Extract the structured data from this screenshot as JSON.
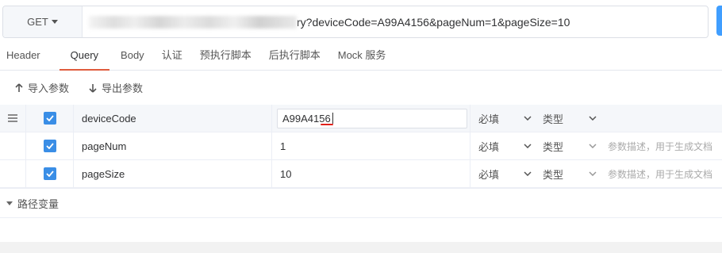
{
  "request": {
    "method": "GET",
    "url_visible": "ry?deviceCode=A99A4156&pageNum=1&pageSize=10"
  },
  "tabs": [
    {
      "label": "Header"
    },
    {
      "label": "Query"
    },
    {
      "label": "Body"
    },
    {
      "label": "认证"
    },
    {
      "label": "预执行脚本"
    },
    {
      "label": "后执行脚本"
    },
    {
      "label": "Mock 服务"
    }
  ],
  "active_tab": "Query",
  "io": {
    "import_label": "导入参数",
    "export_label": "导出参数"
  },
  "params": [
    {
      "key": "deviceCode",
      "value": "A99A4156",
      "required": "必填",
      "type": "类型",
      "description": "",
      "checked": true
    },
    {
      "key": "pageNum",
      "value": "1",
      "required": "必填",
      "type": "类型",
      "description": "参数描述，用于生成文档",
      "checked": true
    },
    {
      "key": "pageSize",
      "value": "10",
      "required": "必填",
      "type": "类型",
      "description": "参数描述，用于生成文档",
      "checked": true
    }
  ],
  "path_vars": {
    "label": "路径变量"
  },
  "icons": {
    "drag": "drag-handle-icon",
    "check": "check-icon",
    "up_arrow": "arrow-up-icon",
    "down_arrow": "arrow-down-icon",
    "chevron": "chevron-down-icon"
  },
  "colors": {
    "accent": "#e05b3d",
    "checkbox": "#3a8ee6",
    "send": "#409eff"
  }
}
